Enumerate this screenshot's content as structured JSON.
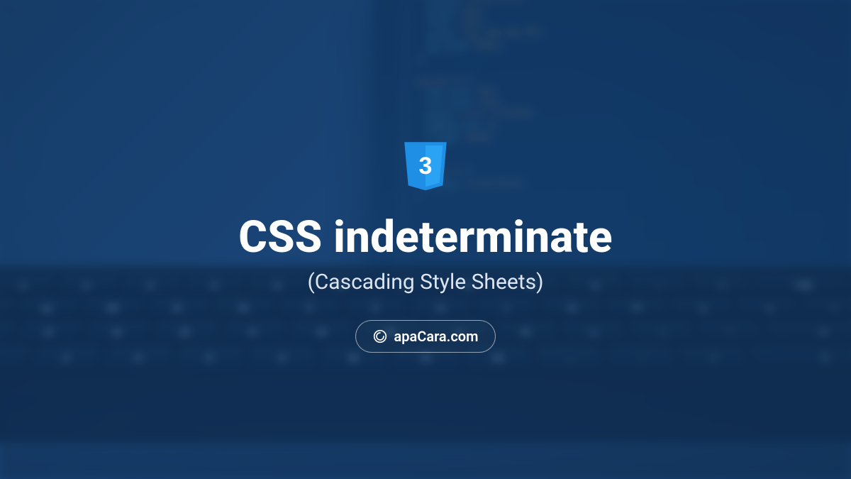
{
  "icon": {
    "name": "css3-badge",
    "glyph": "3",
    "color": "#2196f3"
  },
  "title": "CSS indeterminate",
  "subtitle": "(Cascading Style Sheets)",
  "brand": {
    "logo_glyph": "ə",
    "text": "apaCara.com"
  },
  "background": {
    "description": "Blurred photo of a laptop keyboard with a code editor on screen",
    "code_snippet": "#access {\n  display: inline-block;\n  height: 69px;\n  float: right;\n  margin: 11px 28px 0px 0px;\n  max-width: 800px;\n}\n\n#access ul {\n  font-size: 13px;\n  list-style: none;\n  margin: 0 0 0 -0.8125em;\n  padding-left: 0;\n  z-index: 99999;\n}\n\n#access li {\n  display: inline-block;\n}",
    "line_start": 246
  }
}
